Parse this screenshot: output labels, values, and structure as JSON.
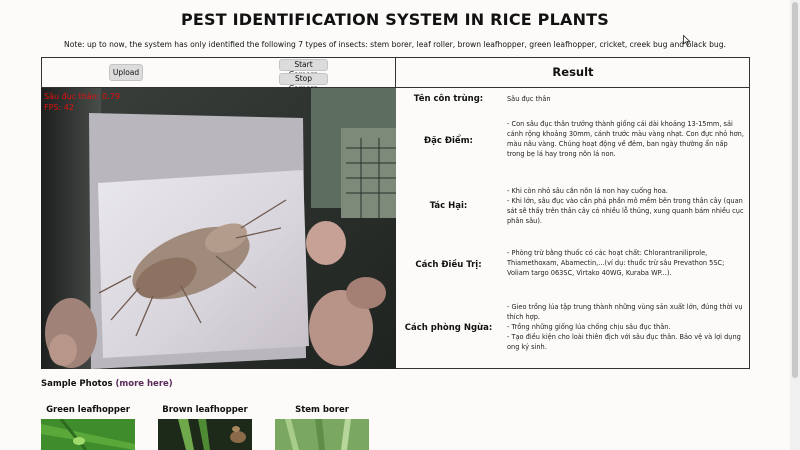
{
  "header": {
    "title": "PEST IDENTIFICATION SYSTEM IN RICE PLANTS",
    "note": "Note: up to now, the system has only identified the following 7 types of insects: stem borer, leaf roller, brown leafhopper, green leafhopper, cricket, creek bug and black bug."
  },
  "controls": {
    "upload_label": "Upload",
    "start_camera_label": "Start Camera",
    "stop_camera_label": "Stop Camera"
  },
  "camera": {
    "detection_label": "Sâu đục thân: 0.79",
    "fps_label": "FPS: 42"
  },
  "result": {
    "heading": "Result",
    "rows": [
      {
        "label": "Tên côn trùng:",
        "text": "Sâu đục thân"
      },
      {
        "label": "Đặc Điểm:",
        "text": "- Con sâu đục thân trưởng thành giống cái dài khoảng 13-15mm, sải cánh rộng khoảng 30mm, cánh trước màu vàng nhạt. Con đực nhỏ hơn, màu nâu vàng. Chúng hoạt động về đêm, ban ngày thường ẩn nấp trong bẹ lá hay trong nõn lá non."
      },
      {
        "label": "Tác Hại:",
        "text": "- Khi còn nhỏ sâu cắn nõn lá non hay cuống hoa.\n- Khi lớn, sâu đục vào cắn phá phần mô mềm bên trong thân cây (quan sát sẽ thấy trên thân cây có nhiều lỗ thủng, xung quanh bám nhiều cục phân sâu)."
      },
      {
        "label": "Cách Điều Trị:",
        "text": "- Phòng trừ bằng thuốc có các hoạt chất: Chlorantraniliprole, Thiamethoxam, Abamectin,...(ví dụ: thuốc trừ sâu Prevathon 5SC; Voliam targo 063SC, Virtako 40WG, Kuraba WP...)."
      },
      {
        "label": "Cách phòng Ngừa:",
        "text": "- Gieo trồng lúa tập trung thành những vùng sản xuất lớn, đúng thời vụ thích hợp.\n- Trồng những giống lúa chống chịu sâu đục thân.\n- Tạo điều kiện cho loài thiên địch với sâu đục thân. Bảo vệ và lợi dụng ong ký sinh."
      }
    ]
  },
  "samples": {
    "heading": "Sample Photos",
    "more_link": "(more here)",
    "items": [
      {
        "name": "Green leafhopper"
      },
      {
        "name": "Brown leafhopper"
      },
      {
        "name": "Stem borer"
      }
    ]
  },
  "colors": {
    "detection_text": "#e01010",
    "link": "#5a2a5a",
    "border": "#333333"
  }
}
